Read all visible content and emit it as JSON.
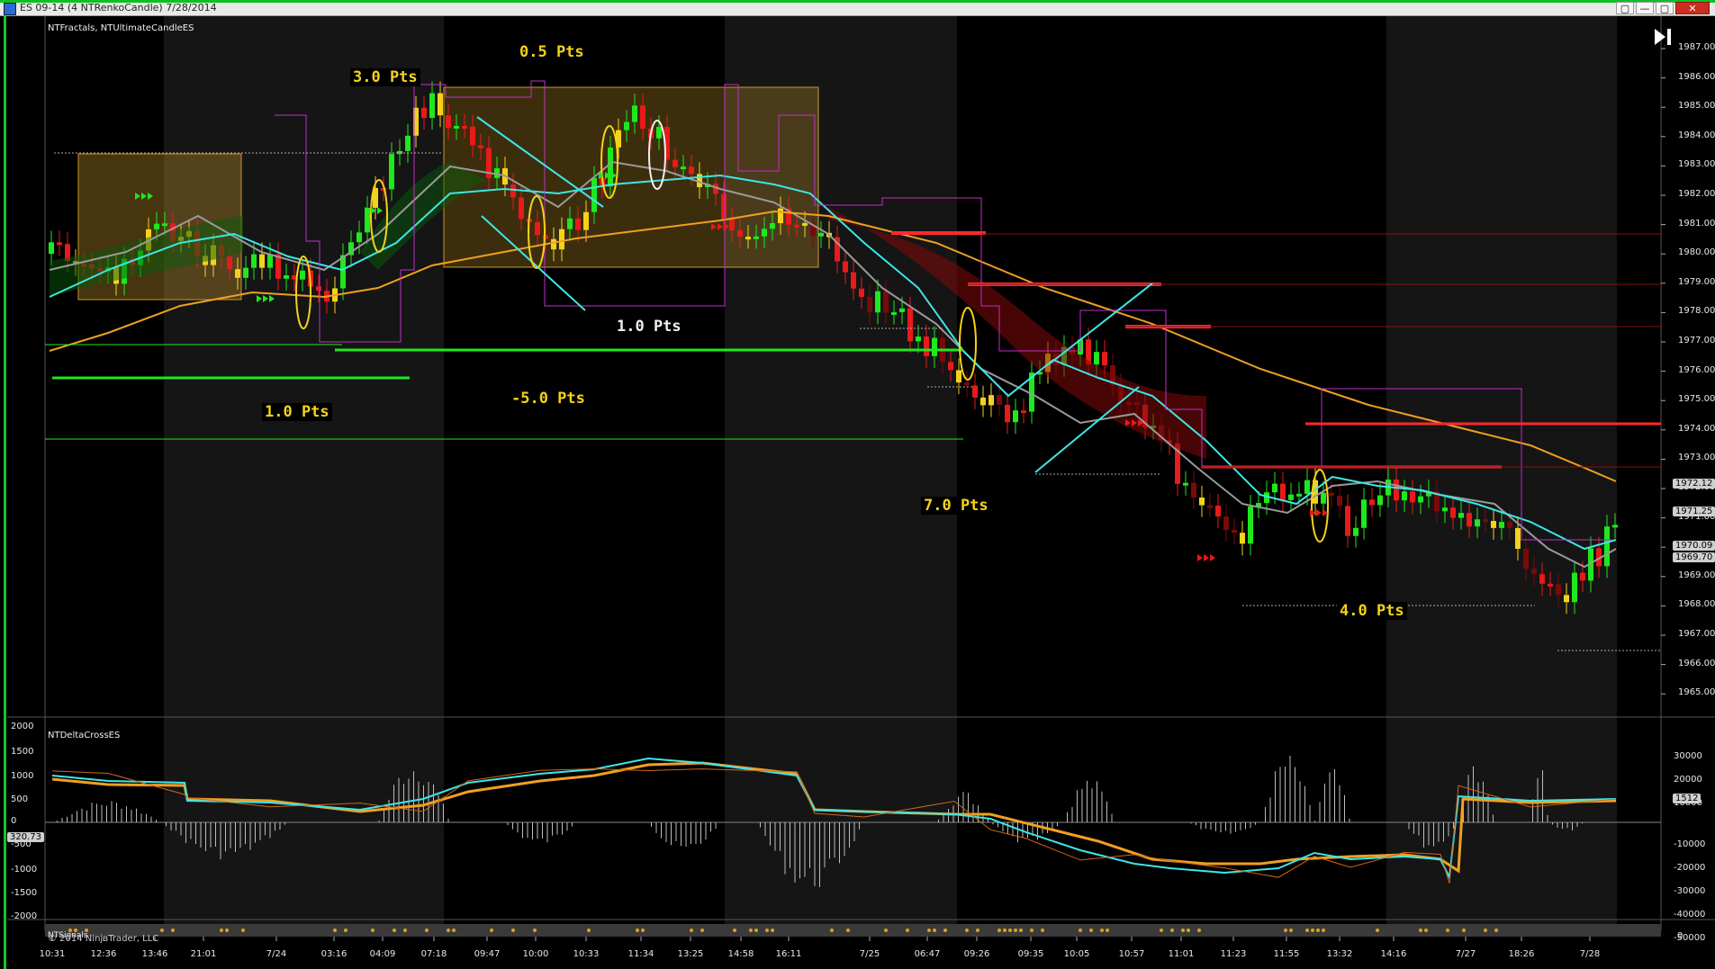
{
  "window": {
    "title": "ES 09-14 (4 NTRenkoCandle)  7/28/2014",
    "buttons": [
      "▢",
      "—",
      "▢",
      "✕"
    ]
  },
  "panels": {
    "price_indicator": "NTFractals, NTUltimateCandleES",
    "delta_indicator": "NTDeltaCrossES",
    "bottom_indicator": "NTSignals"
  },
  "annotations": {
    "pts_3_0": "3.0 Pts",
    "pts_0_5": "0.5 Pts",
    "pts_1_0_white": "1.0 Pts",
    "pts_1_0_left": "1.0 Pts",
    "pts_neg_5_0": "-5.0 Pts",
    "pts_7_0": "7.0 Pts",
    "pts_4_0": "4.0 Pts"
  },
  "copyright": "© 2014 NinjaTrader, LLC",
  "price_axis": {
    "ticks": [
      "1987.00",
      "1986.00",
      "1985.00",
      "1984.00",
      "1983.00",
      "1982.00",
      "1981.00",
      "1980.00",
      "1979.00",
      "1978.00",
      "1977.00",
      "1976.00",
      "1975.00",
      "1974.00",
      "1973.00",
      "1972.00",
      "1971.00",
      "1970.00",
      "1969.00",
      "1968.00",
      "1967.00",
      "1966.00",
      "1965.00"
    ],
    "tags": [
      "1972.12",
      "1971.25",
      "1970.09",
      "1969.70"
    ]
  },
  "delta_axis": {
    "right_ticks": [
      "30000",
      "20000",
      "10000",
      "-10000",
      "-20000",
      "-30000",
      "-40000",
      "-50000"
    ],
    "left_ticks": [
      "2000",
      "1500",
      "1000",
      "500",
      "0",
      "-500",
      "-1000",
      "-1500",
      "-2000"
    ],
    "left_tag": "320.73",
    "right_tag": "1512",
    "bottom_tick": "0"
  },
  "time_axis": [
    "10:31",
    "12:36",
    "13:46",
    "21:01",
    "7/24",
    "03:16",
    "04:09",
    "07:18",
    "09:47",
    "10:00",
    "10:33",
    "11:34",
    "13:25",
    "14:58",
    "16:11",
    "7/25",
    "06:47",
    "09:26",
    "09:35",
    "10:05",
    "10:57",
    "11:01",
    "11:23",
    "11:55",
    "13:32",
    "14:16",
    "7/27",
    "18:26",
    "7/28"
  ],
  "colors": {
    "bull": "#1ee81e",
    "bear": "#e81a1a",
    "neutral": "#f5d21a",
    "cyan": "#3ee6e6",
    "orange": "#f0a020",
    "magenta": "#c030c8",
    "box": "#c8982a"
  }
}
